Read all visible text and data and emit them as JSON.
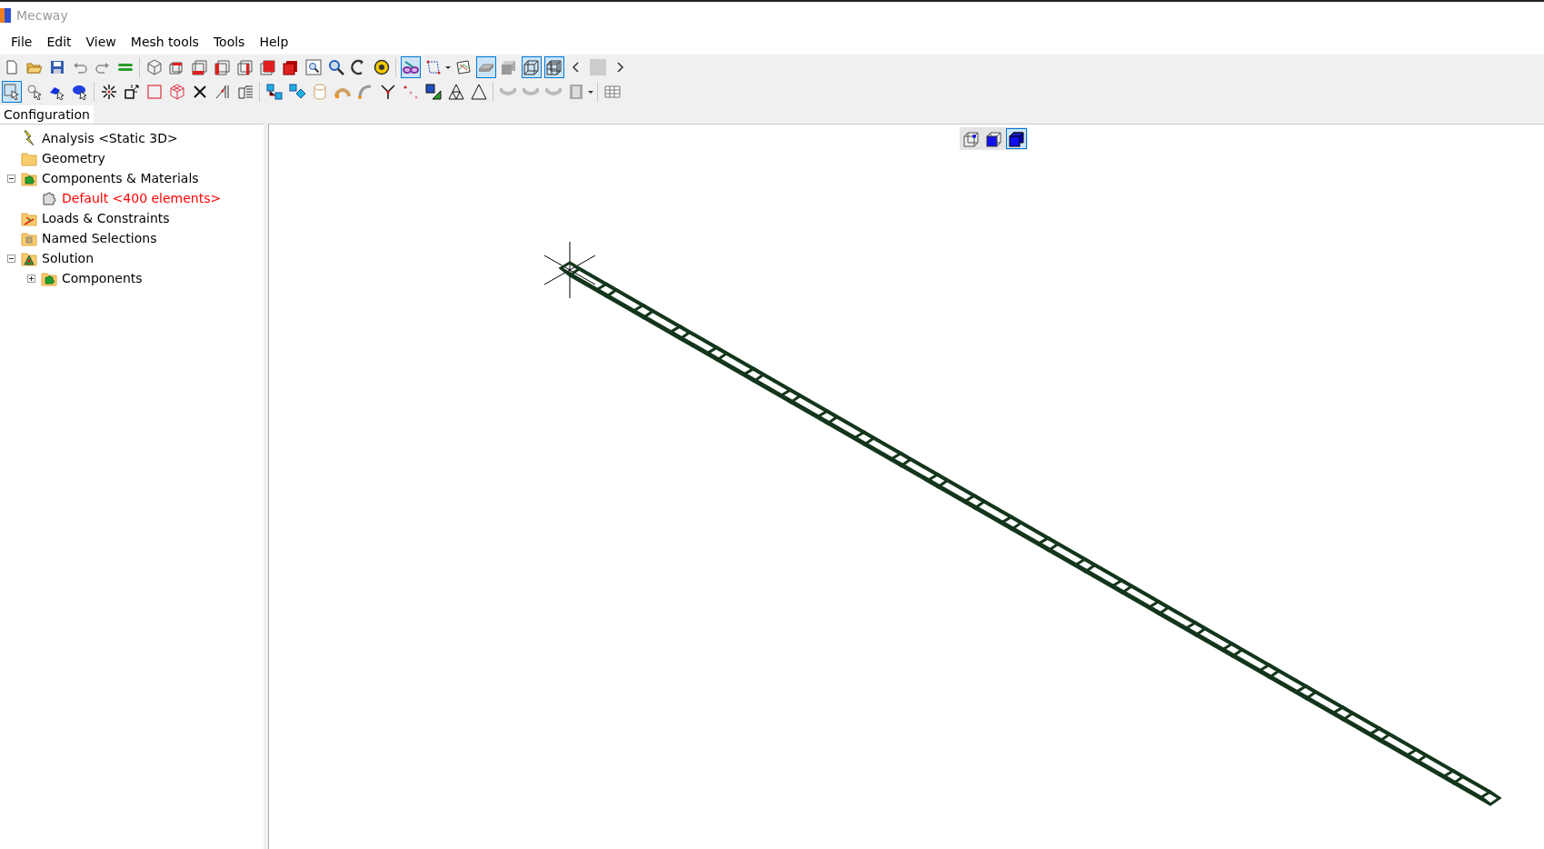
{
  "window": {
    "title": "Mecway"
  },
  "menu": [
    "File",
    "Edit",
    "View",
    "Mesh tools",
    "Tools",
    "Help"
  ],
  "toolbars": [
    [
      {
        "kind": "new",
        "selected": false
      },
      {
        "kind": "open",
        "selected": false
      },
      {
        "kind": "save",
        "selected": false
      },
      {
        "kind": "undo",
        "selected": false
      },
      {
        "kind": "redo",
        "selected": false
      },
      {
        "kind": "bars",
        "selected": false
      },
      {
        "kind": "sep"
      },
      {
        "kind": "cube-wire",
        "selected": false
      },
      {
        "kind": "cube-top",
        "selected": false
      },
      {
        "kind": "cube-bottom",
        "selected": false
      },
      {
        "kind": "cube-left",
        "selected": false
      },
      {
        "kind": "cube-right",
        "selected": false
      },
      {
        "kind": "cube-back",
        "selected": false
      },
      {
        "kind": "cube-red",
        "selected": false
      },
      {
        "kind": "zoom-box",
        "selected": false
      },
      {
        "kind": "magnifier",
        "selected": false
      },
      {
        "kind": "rotate",
        "selected": false
      },
      {
        "kind": "measure",
        "selected": false
      },
      {
        "kind": "sep"
      },
      {
        "kind": "glasses",
        "selected": true
      },
      {
        "kind": "nodes",
        "selected": false
      },
      {
        "kind": "caret"
      },
      {
        "kind": "sketch",
        "selected": false
      },
      {
        "kind": "plate",
        "selected": true
      },
      {
        "kind": "solid",
        "selected": false
      },
      {
        "kind": "wire",
        "selected": true
      },
      {
        "kind": "mesh",
        "selected": true
      },
      {
        "kind": "chevron-left"
      },
      {
        "kind": "blank"
      },
      {
        "kind": "chevron-right"
      }
    ],
    [
      {
        "kind": "select-box",
        "selected": true
      },
      {
        "kind": "pointer",
        "selected": false
      },
      {
        "kind": "select-blue",
        "selected": false
      },
      {
        "kind": "select-oval",
        "selected": false
      },
      {
        "kind": "sep"
      },
      {
        "kind": "explode",
        "selected": false
      },
      {
        "kind": "node-box",
        "selected": false
      },
      {
        "kind": "square",
        "selected": false
      },
      {
        "kind": "cube-pink",
        "selected": false
      },
      {
        "kind": "cross",
        "selected": false
      },
      {
        "kind": "split",
        "selected": false
      },
      {
        "kind": "extrude",
        "selected": false
      },
      {
        "kind": "sep"
      },
      {
        "kind": "squares",
        "selected": false
      },
      {
        "kind": "diamond",
        "selected": false
      },
      {
        "kind": "cylinder",
        "selected": false
      },
      {
        "kind": "bend",
        "selected": false
      },
      {
        "kind": "curve",
        "selected": false
      },
      {
        "kind": "fork",
        "selected": false
      },
      {
        "kind": "dots",
        "selected": false
      },
      {
        "kind": "green-arrow",
        "selected": false
      },
      {
        "kind": "tri-mesh",
        "selected": false
      },
      {
        "kind": "triangle",
        "selected": false
      },
      {
        "kind": "sep"
      },
      {
        "kind": "arc",
        "selected": false
      },
      {
        "kind": "arc",
        "selected": false
      },
      {
        "kind": "arc",
        "selected": false
      },
      {
        "kind": "film",
        "selected": false
      },
      {
        "kind": "caret"
      },
      {
        "kind": "sep"
      },
      {
        "kind": "table",
        "selected": false
      }
    ]
  ],
  "tab": {
    "label": "Configuration"
  },
  "tree": [
    {
      "label": "Analysis <Static 3D>",
      "kind": "lightning",
      "color": "#000000"
    },
    {
      "label": "Geometry",
      "kind": "folder",
      "color": "#000000"
    },
    {
      "label": "Components & Materials",
      "kind": "folder-component",
      "color": "#000000",
      "expanded": true,
      "children": [
        {
          "label": "Default <400 elements>",
          "kind": "component",
          "color": "#ff0000"
        }
      ]
    },
    {
      "label": "Loads & Constraints",
      "kind": "folder-loads",
      "color": "#000000"
    },
    {
      "label": "Named Selections",
      "kind": "folder-selection",
      "color": "#000000"
    },
    {
      "label": "Solution",
      "kind": "folder-solution",
      "color": "#000000",
      "expanded": true,
      "children": [
        {
          "label": "Components",
          "kind": "folder-component",
          "color": "#000000",
          "expanded": false
        }
      ]
    }
  ],
  "view_buttons": [
    {
      "kind": "cube-node",
      "selected": false
    },
    {
      "kind": "cube-face",
      "selected": false
    },
    {
      "kind": "cube-solid",
      "selected": true
    }
  ]
}
